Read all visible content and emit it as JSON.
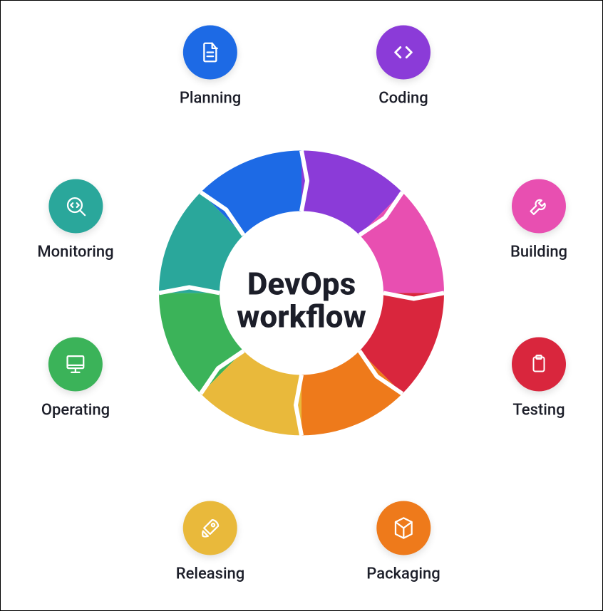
{
  "title_line1": "DevOps",
  "title_line2": "workflow",
  "stages": [
    {
      "key": "planning",
      "label": "Planning",
      "color": "#1d6ae5",
      "icon": "document-icon"
    },
    {
      "key": "coding",
      "label": "Coding",
      "color": "#8b3bd8",
      "icon": "code-icon"
    },
    {
      "key": "building",
      "label": "Building",
      "color": "#e84fb1",
      "icon": "wrench-icon"
    },
    {
      "key": "testing",
      "label": "Testing",
      "color": "#d9263d",
      "icon": "clipboard-icon"
    },
    {
      "key": "packaging",
      "label": "Packaging",
      "color": "#ee7a1b",
      "icon": "cube-icon"
    },
    {
      "key": "releasing",
      "label": "Releasing",
      "color": "#e9b93b",
      "icon": "rocket-icon"
    },
    {
      "key": "operating",
      "label": "Operating",
      "color": "#3bb359",
      "icon": "computer-icon"
    },
    {
      "key": "monitoring",
      "label": "Monitoring",
      "color": "#2aa79b",
      "icon": "magnify-code-icon"
    }
  ],
  "chart_data": {
    "type": "pie",
    "title": "DevOps workflow",
    "categories": [
      "Planning",
      "Coding",
      "Building",
      "Testing",
      "Packaging",
      "Releasing",
      "Operating",
      "Monitoring"
    ],
    "values": [
      1,
      1,
      1,
      1,
      1,
      1,
      1,
      1
    ],
    "colors": [
      "#1d6ae5",
      "#8b3bd8",
      "#e84fb1",
      "#d9263d",
      "#ee7a1b",
      "#e9b93b",
      "#3bb359",
      "#2aa79b"
    ],
    "ordered_clockwise_starting_at_top_left": true
  }
}
